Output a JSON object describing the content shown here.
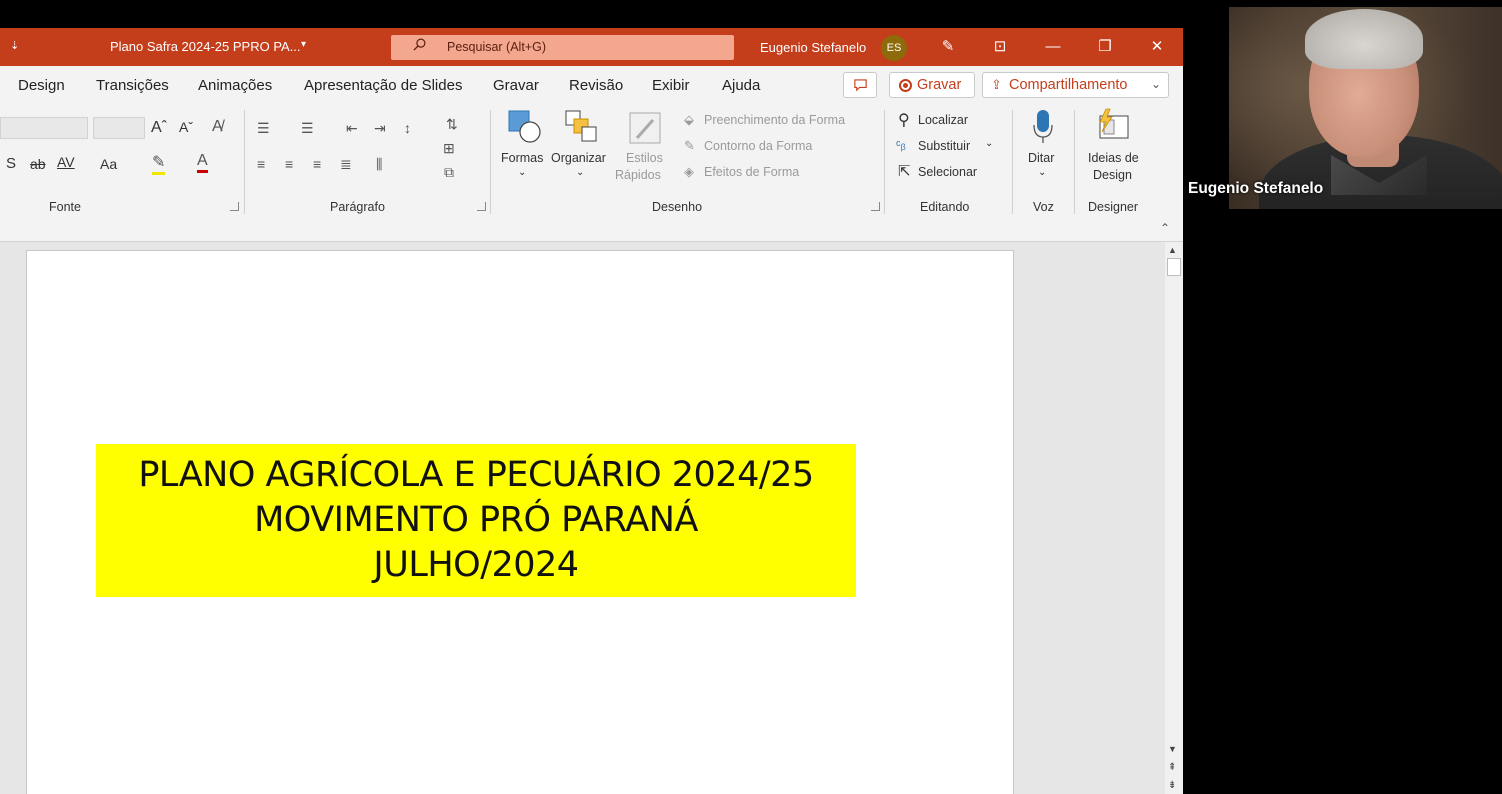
{
  "titlebar": {
    "quick_access": "⇣",
    "doc_title": "Plano Safra 2024-25 PPRO PA...",
    "doc_caret": "▾",
    "search_placeholder": "Pesquisar (Alt+G)",
    "user_name": "Eugenio Stefanelo",
    "user_initials": "ES",
    "accent_color": "#c43e1c"
  },
  "tabs": {
    "items": [
      "Design",
      "Transições",
      "Animações",
      "Apresentação de Slides",
      "Gravar",
      "Revisão",
      "Exibir",
      "Ajuda"
    ],
    "gravar_button": "Gravar",
    "share_button": "Compartilhamento"
  },
  "ribbon": {
    "groups": {
      "fonte": "Fonte",
      "paragrafo": "Parágrafo",
      "desenho": "Desenho",
      "editando": "Editando",
      "voz": "Voz",
      "designer": "Designer"
    },
    "fonte": {
      "grow": "Aˆ",
      "shrink": "Aˇ",
      "strike_s": "S",
      "strike_ab": "ab",
      "spacing": "AV",
      "case": "Aa"
    },
    "desenho": {
      "formas": "Formas",
      "organizar": "Organizar",
      "estilos_1": "Estilos",
      "estilos_2": "Rápidos",
      "preenchimento": "Preenchimento da Forma",
      "contorno": "Contorno da Forma",
      "efeitos": "Efeitos de Forma"
    },
    "editando": {
      "localizar": "Localizar",
      "substituir": "Substituir",
      "selecionar": "Selecionar"
    },
    "voz": {
      "ditar": "Ditar"
    },
    "designer": {
      "ideias_1": "Ideias de",
      "ideias_2": "Design"
    }
  },
  "slide": {
    "banner_color": "#ffff00",
    "line1": "PLANO AGRÍCOLA E PECUÁRIO 2024/25",
    "line2": "MOVIMENTO PRÓ PARANÁ",
    "line3": "JULHO/2024"
  },
  "webcam": {
    "participant_name": "Eugenio Stefanelo"
  }
}
